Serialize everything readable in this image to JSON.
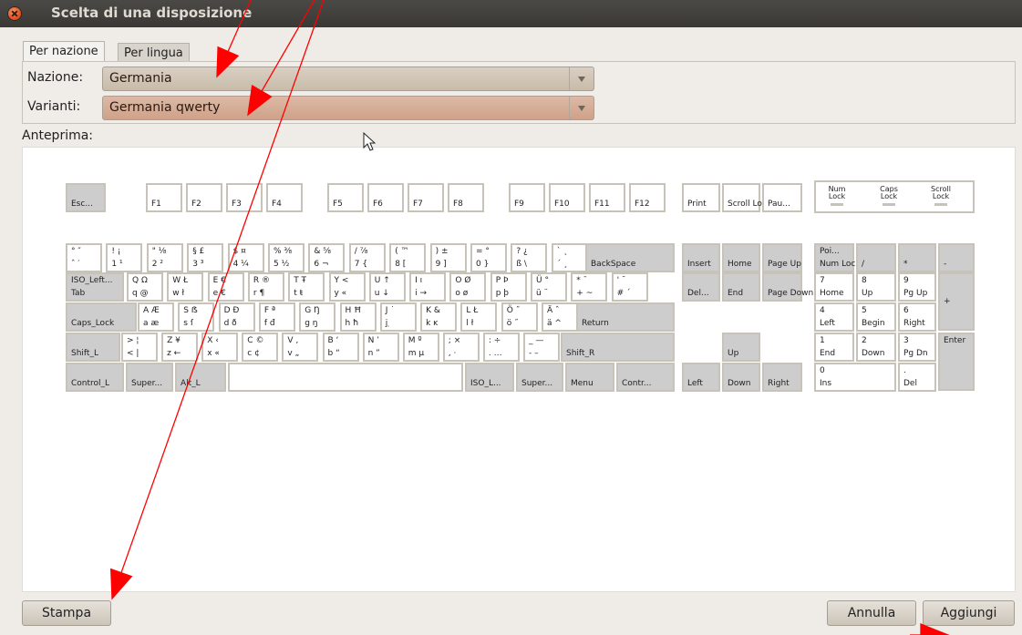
{
  "window": {
    "title": "Scelta di una disposizione"
  },
  "tabs": [
    {
      "label": "Per nazione"
    },
    {
      "label": "Per lingua"
    }
  ],
  "form": {
    "country_label": "Nazione:",
    "country_value": "Germania",
    "variant_label": "Varianti:",
    "variant_value": "Germania qwerty"
  },
  "preview_label": "Anteprima:",
  "keyboard": {
    "indicators": [
      "Num Lock",
      "Caps Lock",
      "Scroll Lock"
    ],
    "keys": [
      {
        "id": "esc",
        "tl": "",
        "tr": "",
        "bl": "Esc...",
        "br": ""
      },
      {
        "id": "f1",
        "bl": "F1"
      },
      {
        "id": "f2",
        "bl": "F2"
      },
      {
        "id": "f3",
        "bl": "F3"
      },
      {
        "id": "f4",
        "bl": "F4"
      },
      {
        "id": "f5",
        "bl": "F5"
      },
      {
        "id": "f6",
        "bl": "F6"
      },
      {
        "id": "f7",
        "bl": "F7"
      },
      {
        "id": "f8",
        "bl": "F8"
      },
      {
        "id": "f9",
        "bl": "F9"
      },
      {
        "id": "f10",
        "bl": "F10"
      },
      {
        "id": "f11",
        "bl": "F11"
      },
      {
        "id": "f12",
        "bl": "F12"
      },
      {
        "id": "print",
        "bl": "Print"
      },
      {
        "id": "scroll",
        "bl": "Scroll Lock"
      },
      {
        "id": "pause",
        "bl": "Pau..."
      },
      {
        "id": "tld",
        "tl": "° ″",
        "bl": "ˆ ′"
      },
      {
        "id": "d1",
        "tl": "! ¡",
        "bl": "1 ¹"
      },
      {
        "id": "d2",
        "tl": "\" ⅛",
        "bl": "2 ²"
      },
      {
        "id": "d3",
        "tl": "§ £",
        "bl": "3 ³"
      },
      {
        "id": "d4",
        "tl": "$ ¤",
        "bl": "4 ¼"
      },
      {
        "id": "d5",
        "tl": "% ⅜",
        "bl": "5 ½"
      },
      {
        "id": "d6",
        "tl": "& ⅝",
        "bl": "6 ¬"
      },
      {
        "id": "d7",
        "tl": "/ ⅞",
        "bl": "7 {"
      },
      {
        "id": "d8",
        "tl": "( ™",
        "bl": "8 ["
      },
      {
        "id": "d9",
        "tl": ") ±",
        "bl": "9 ]"
      },
      {
        "id": "d0",
        "tl": "= °",
        "bl": "0 }"
      },
      {
        "id": "ss",
        "tl": "? ¿",
        "bl": "ß \\"
      },
      {
        "id": "acc",
        "tl": "` ˛",
        "bl": "´ ¸"
      },
      {
        "id": "bksp",
        "bl": "BackSpace"
      },
      {
        "id": "tab",
        "tl": "ISO_Left...",
        "bl": "Tab"
      },
      {
        "id": "q",
        "tl": "Q Ω",
        "bl": "q @"
      },
      {
        "id": "w",
        "tl": "W Ł",
        "bl": "w ł"
      },
      {
        "id": "e",
        "tl": "E €",
        "bl": "e €"
      },
      {
        "id": "r",
        "tl": "R ®",
        "bl": "r ¶"
      },
      {
        "id": "t",
        "tl": "T Ŧ",
        "bl": "t ŧ"
      },
      {
        "id": "y",
        "tl": "Y <",
        "bl": "y «"
      },
      {
        "id": "u",
        "tl": "U ↑",
        "bl": "u ↓"
      },
      {
        "id": "i",
        "tl": "I ı",
        "bl": "i →"
      },
      {
        "id": "o",
        "tl": "O Ø",
        "bl": "o ø"
      },
      {
        "id": "p",
        "tl": "P Þ",
        "bl": "p þ"
      },
      {
        "id": "ue",
        "tl": "Ü °",
        "bl": "ü ¨"
      },
      {
        "id": "plus",
        "tl": "* ¯",
        "bl": "+ ~"
      },
      {
        "id": "hash",
        "tl": "' ˘",
        "bl": "# ´"
      },
      {
        "id": "caps",
        "bl": "Caps_Lock"
      },
      {
        "id": "a",
        "tl": "A Æ",
        "bl": "a æ"
      },
      {
        "id": "s",
        "tl": "S ẞ",
        "bl": "s ſ"
      },
      {
        "id": "d",
        "tl": "D Ð",
        "bl": "d ð"
      },
      {
        "id": "f",
        "tl": "F ª",
        "bl": "f đ"
      },
      {
        "id": "g",
        "tl": "G Ŋ",
        "bl": "g ŋ"
      },
      {
        "id": "h",
        "tl": "H Ħ",
        "bl": "h ħ"
      },
      {
        "id": "j",
        "tl": "J ˙",
        "bl": "j ̣"
      },
      {
        "id": "k",
        "tl": "K &",
        "bl": "k ĸ"
      },
      {
        "id": "l",
        "tl": "L Ł",
        "bl": "l ł"
      },
      {
        "id": "oe",
        "tl": "Ö ˝",
        "bl": "ö ˝"
      },
      {
        "id": "ae",
        "tl": "Ä ˆ",
        "bl": "ä ^"
      },
      {
        "id": "ret",
        "bl": "Return"
      },
      {
        "id": "shl",
        "bl": "Shift_L"
      },
      {
        "id": "lt",
        "tl": "> ¦",
        "bl": "< |"
      },
      {
        "id": "z",
        "tl": "Z ¥",
        "bl": "z ←"
      },
      {
        "id": "x",
        "tl": "X ‹",
        "bl": "x «"
      },
      {
        "id": "c",
        "tl": "C ©",
        "bl": "c ¢"
      },
      {
        "id": "v",
        "tl": "V ‚",
        "bl": "v „"
      },
      {
        "id": "b",
        "tl": "B ‘",
        "bl": "b “"
      },
      {
        "id": "n",
        "tl": "N ’",
        "bl": "n ”"
      },
      {
        "id": "m",
        "tl": "M º",
        "bl": "m µ"
      },
      {
        "id": "comma",
        "tl": "; ×",
        "bl": ", ·"
      },
      {
        "id": "dot",
        "tl": ": ÷",
        "bl": ". …"
      },
      {
        "id": "minus",
        "tl": "_ —",
        "bl": "- –"
      },
      {
        "id": "shr",
        "bl": "Shift_R"
      },
      {
        "id": "ctl",
        "bl": "Control_L"
      },
      {
        "id": "supl",
        "bl": "Super..."
      },
      {
        "id": "alt",
        "bl": "Alt_L"
      },
      {
        "id": "space",
        "bl": ""
      },
      {
        "id": "iso",
        "bl": "ISO_L..."
      },
      {
        "id": "supr",
        "bl": "Super..."
      },
      {
        "id": "menu",
        "bl": "Menu"
      },
      {
        "id": "ctr",
        "bl": "Contr..."
      },
      {
        "id": "ins",
        "bl": "Insert"
      },
      {
        "id": "home",
        "bl": "Home"
      },
      {
        "id": "pgup",
        "bl": "Page Up"
      },
      {
        "id": "del",
        "bl": "Del..."
      },
      {
        "id": "end",
        "bl": "End"
      },
      {
        "id": "pgdn",
        "bl": "Page Down"
      },
      {
        "id": "up",
        "bl": "Up"
      },
      {
        "id": "left",
        "bl": "Left"
      },
      {
        "id": "down",
        "bl": "Down"
      },
      {
        "id": "right",
        "bl": "Right"
      },
      {
        "id": "numlock",
        "tl": "Poi...",
        "bl": "Num Lock"
      },
      {
        "id": "kpdiv",
        "bl": "/"
      },
      {
        "id": "kpmul",
        "bl": "*"
      },
      {
        "id": "kpsub",
        "bl": "-"
      },
      {
        "id": "kp7",
        "tl": "7",
        "bl": "Home"
      },
      {
        "id": "kp8",
        "tl": "8",
        "bl": "Up"
      },
      {
        "id": "kp9",
        "tl": "9",
        "bl": "Pg Up"
      },
      {
        "id": "kpadd",
        "ml": "+"
      },
      {
        "id": "kp4",
        "tl": "4",
        "bl": "Left"
      },
      {
        "id": "kp5",
        "tl": "5",
        "bl": "Begin"
      },
      {
        "id": "kp6",
        "tl": "6",
        "bl": "Right"
      },
      {
        "id": "kp1",
        "tl": "1",
        "bl": "End"
      },
      {
        "id": "kp2",
        "tl": "2",
        "bl": "Down"
      },
      {
        "id": "kp3",
        "tl": "3",
        "bl": "Pg Dn"
      },
      {
        "id": "kpent",
        "tl": "Enter"
      },
      {
        "id": "kp0",
        "tl": "0",
        "bl": "Ins"
      },
      {
        "id": "kpdot",
        "tl": ".",
        "bl": "Del"
      }
    ]
  },
  "buttons": {
    "print": "Stampa",
    "cancel": "Annulla",
    "add": "Aggiungi"
  },
  "colors": {
    "annotation": "#ff0000"
  }
}
